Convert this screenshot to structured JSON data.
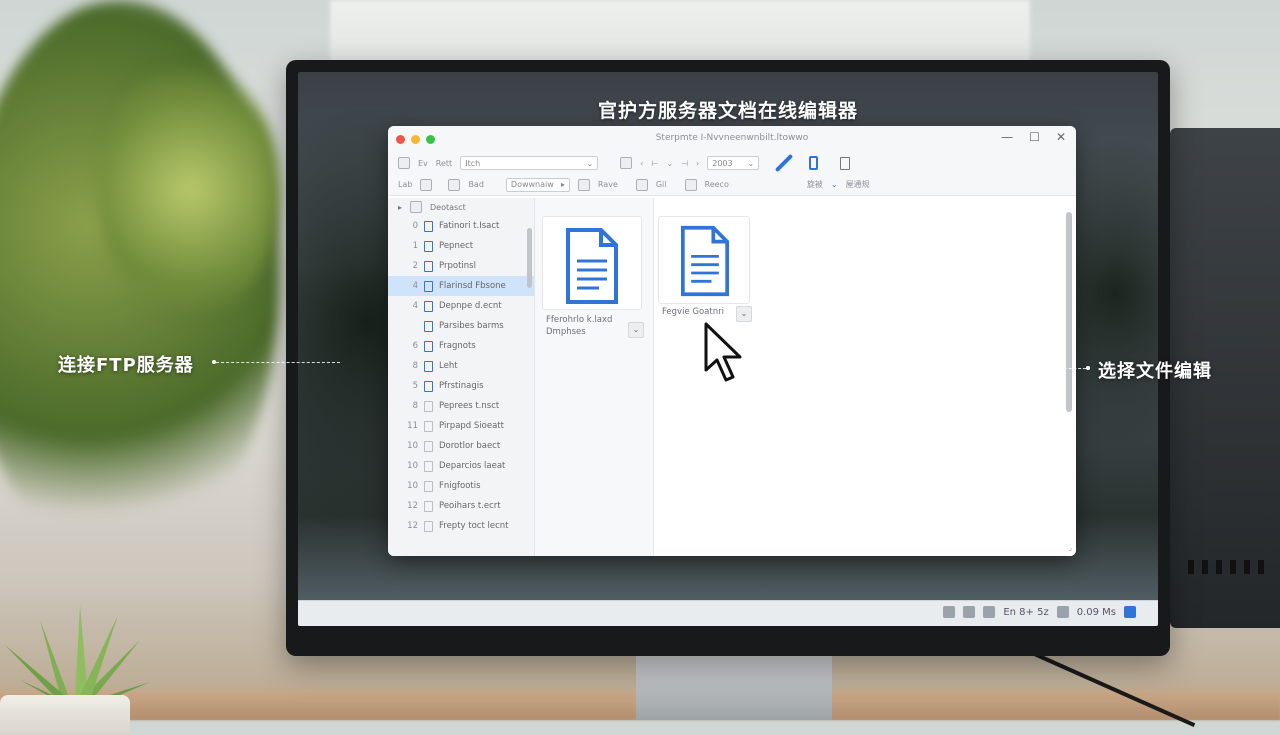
{
  "screen_title": "官护方服务器文档在线编辑器",
  "callouts": {
    "left": "连接FTP服务器",
    "right": "选择文件编辑"
  },
  "colors": {
    "accent": "#2f74d9",
    "close_dot": "#f0554a",
    "min_dot": "#f7b733",
    "max_dot": "#37c24b"
  },
  "icons": {
    "minimize": "—",
    "maximize": "☐",
    "close": "✕",
    "chevron_down": "⌄"
  },
  "toolbar": {
    "row1": {
      "label_a": "Ev",
      "label_b": "Rett",
      "dropdown_value": "Itch",
      "number_value": "2003"
    },
    "row2": {
      "label_a": "Lab",
      "label_b": "Bad",
      "dropdown_value": "Dowwnaiw",
      "label_c": "Rave",
      "label_d": "Gil",
      "label_e": "Reeco",
      "label_f": "旋被",
      "label_g": "屋通规"
    }
  },
  "tree": {
    "header": "Deotasct",
    "items": [
      {
        "num": "0",
        "label": "Fatinori t.Isact"
      },
      {
        "num": "1",
        "label": "Pepnect"
      },
      {
        "num": "2",
        "label": "Prpotinsl"
      },
      {
        "num": "4",
        "label": "Flarinsd Fbsone"
      },
      {
        "num": "4",
        "label": "Depnpe d.ecnt"
      },
      {
        "num": "",
        "label": "Parsibes barms"
      },
      {
        "num": "6",
        "label": "Fragnots"
      },
      {
        "num": "8",
        "label": "Leht"
      },
      {
        "num": "5",
        "label": "Pfrstinagis"
      },
      {
        "num": "8",
        "label": "Peprees t.nsct"
      },
      {
        "num": "11",
        "label": "Pirpapd Sioeatt"
      },
      {
        "num": "10",
        "label": "Dorotlor baect"
      },
      {
        "num": "10",
        "label": "Deparcios laeat"
      },
      {
        "num": "10",
        "label": "Fnigfootis"
      },
      {
        "num": "12",
        "label": "Peoihars t.ecrt"
      },
      {
        "num": "12",
        "label": "Frepty toct lecnt"
      }
    ]
  },
  "cards": [
    {
      "label_line1": "Fferohrlo k.laxd",
      "label_line2": "Dmphses"
    },
    {
      "label_line1": "Fegvie Goatnri",
      "label_line2": ""
    }
  ]
}
